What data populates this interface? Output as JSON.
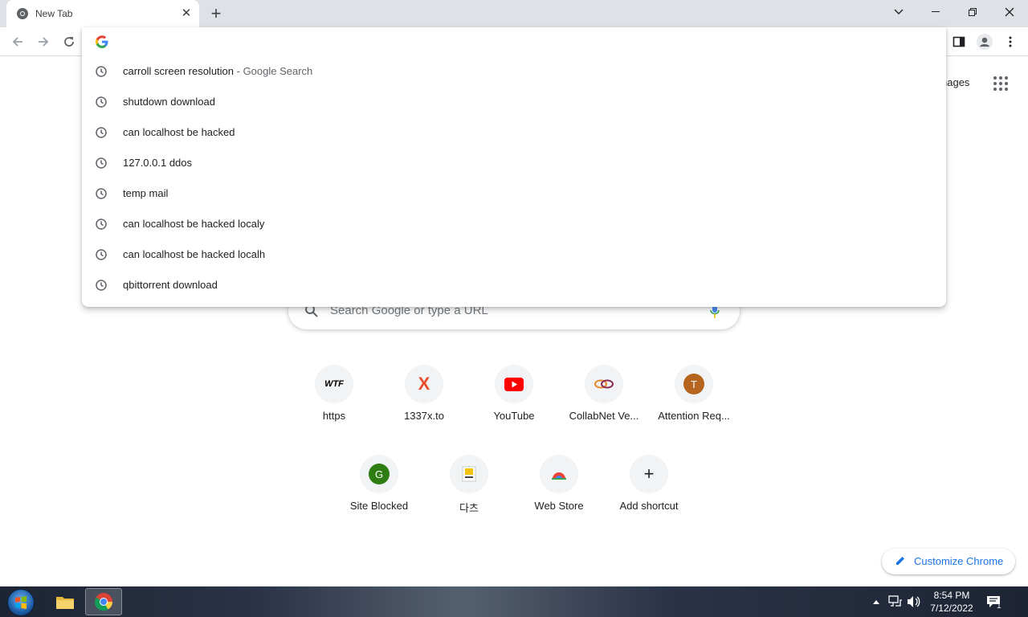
{
  "tab": {
    "title": "New Tab"
  },
  "omnibox": {
    "value": "",
    "suggestions": [
      {
        "text": "carroll screen resolution",
        "suffix": " - Google Search"
      },
      {
        "text": "shutdown download",
        "suffix": ""
      },
      {
        "text": "can localhost be hacked",
        "suffix": ""
      },
      {
        "text": "127.0.0.1 ddos",
        "suffix": ""
      },
      {
        "text": "temp mail",
        "suffix": ""
      },
      {
        "text": "can localhost be hacked localy",
        "suffix": ""
      },
      {
        "text": "can localhost be hacked localh",
        "suffix": ""
      },
      {
        "text": "qbittorrent download",
        "suffix": ""
      }
    ]
  },
  "page": {
    "images_link": "nages",
    "search_placeholder": "Search Google or type a URL",
    "shortcuts": [
      {
        "label": "https",
        "icon": "wtf-icon",
        "glyph": "WTF"
      },
      {
        "label": "1337x.to",
        "icon": "1337x-icon",
        "glyph": "X"
      },
      {
        "label": "YouTube",
        "icon": "youtube-icon",
        "glyph": ""
      },
      {
        "label": "CollabNet Ve...",
        "icon": "collabnet-icon",
        "glyph": ""
      },
      {
        "label": "Attention Req...",
        "icon": "letter-t-icon",
        "glyph": "T"
      },
      {
        "label": "Site Blocked",
        "icon": "letter-g-icon",
        "glyph": "G"
      },
      {
        "label": "다츠",
        "icon": "dachu-icon",
        "glyph": ""
      },
      {
        "label": "Web Store",
        "icon": "web-store-icon",
        "glyph": ""
      },
      {
        "label": "Add shortcut",
        "icon": "plus-icon",
        "glyph": "+"
      }
    ],
    "customize_label": "Customize Chrome"
  },
  "taskbar": {
    "time": "8:54 PM",
    "date": "7/12/2022",
    "notification_count": "1"
  },
  "colors": {
    "accent": "#1a73e8",
    "tabstrip": "#dee1e6",
    "youtube": "#ff0000",
    "avatar_t": "#b5651d",
    "avatar_g": "#2e7d13"
  }
}
